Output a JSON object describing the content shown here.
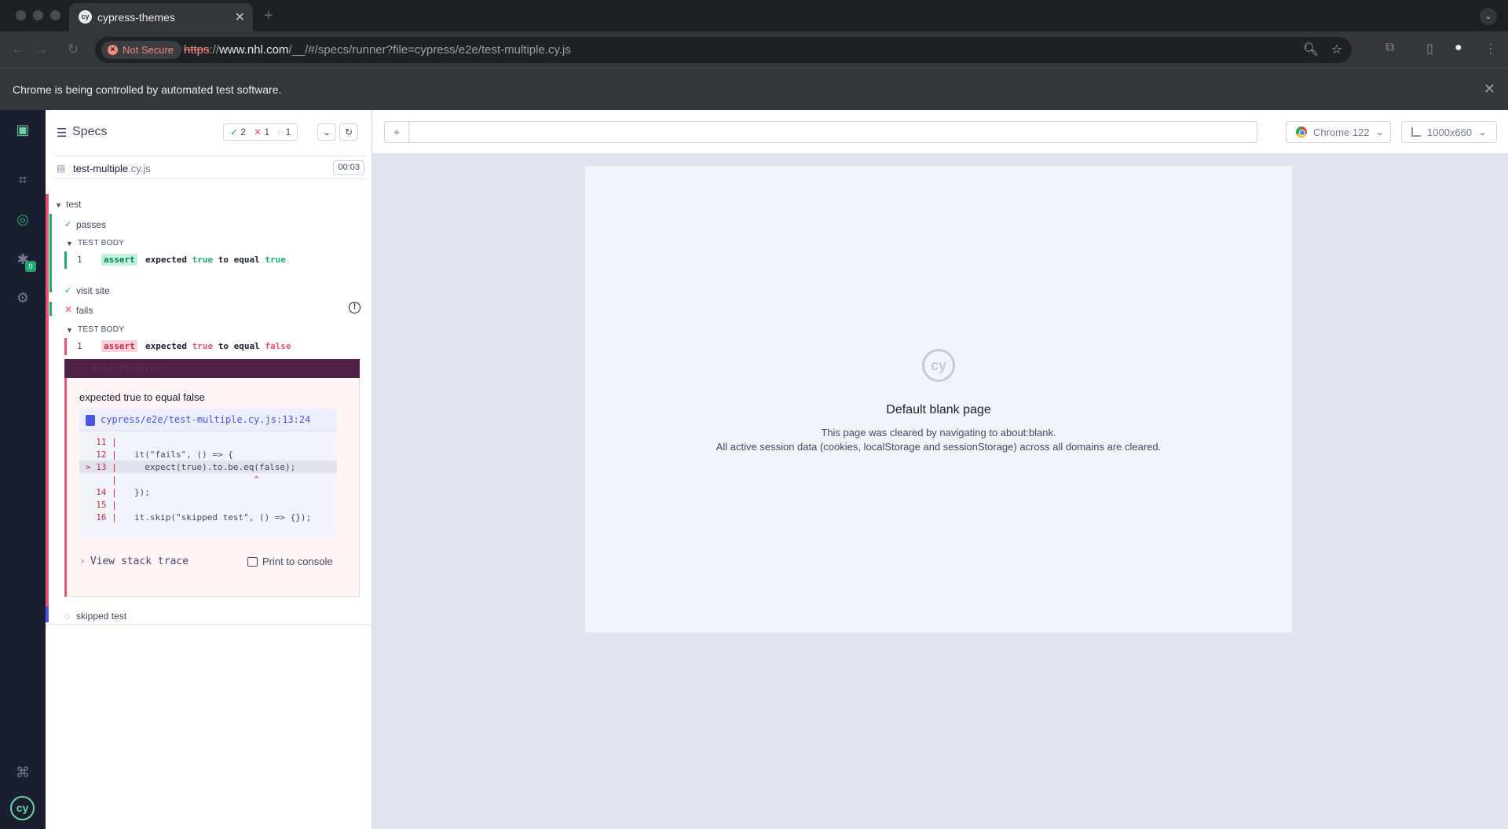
{
  "browser": {
    "tab_title": "cypress-themes",
    "tab_favicon": "cy",
    "security_label": "Not Secure",
    "url_scheme": "https",
    "url_sep": "://",
    "url_host": "www.nhl.com",
    "url_path": "/__/#/specs/runner?file=cypress/e2e/test-multiple.cy.js",
    "infobar_text": "Chrome is being controlled by automated test software."
  },
  "sidenav": {
    "debug_badge": "0",
    "logo": "cy"
  },
  "reporter": {
    "specs_label": "Specs",
    "stats": {
      "passed": "2",
      "failed": "1",
      "pending": "1"
    },
    "file": {
      "name": "test-multiple",
      "ext": ".cy.js",
      "duration": "00:03"
    },
    "suite_title": "test",
    "tests": {
      "passes": "passes",
      "visit_site": "visit site",
      "fails": "fails",
      "skipped": "skipped test"
    },
    "test_body_label": "TEST BODY",
    "commands": [
      {
        "num": "1",
        "name": "assert",
        "w1": "expected ",
        "v1": "true",
        "w2": " to equal ",
        "v2": "true"
      },
      {
        "num": "1",
        "name": "assert",
        "w1": "expected ",
        "v1": "true",
        "w2": " to equal ",
        "v2": "false"
      }
    ],
    "error": {
      "bar_text": "AssertionError",
      "message": "expected true to equal false",
      "file_path": "cypress/e2e/test-multiple.cy.js:13:24",
      "code_lines": [
        {
          "ln": "  11 |",
          "src": ""
        },
        {
          "ln": "  12 |",
          "src": "it(\"fails\", () => {"
        },
        {
          "ln": "> 13 |",
          "src": "  expect(true).to.be.eq(false);"
        },
        {
          "ln": "     |",
          "src": "                       ^"
        },
        {
          "ln": "  14 |",
          "src": "});"
        },
        {
          "ln": "  15 |",
          "src": ""
        },
        {
          "ln": "  16 |",
          "src": "it.skip(\"skipped test\", () => {});"
        }
      ],
      "stack_label": "View stack trace",
      "print_label": "Print to console"
    }
  },
  "preview": {
    "browser_label": "Chrome 122",
    "viewport_label": "1000x660",
    "blank_title": "Default blank page",
    "blank_line1": "This page was cleared by navigating to about:blank.",
    "blank_line2": "All active session data (cookies, localStorage and sessionStorage) across all domains are cleared.",
    "logo": "cy"
  },
  "colors": {
    "pass": "#1fa971",
    "fail": "#e45770",
    "pending": "#4956e3",
    "nav_bg": "#1b1e2e"
  }
}
